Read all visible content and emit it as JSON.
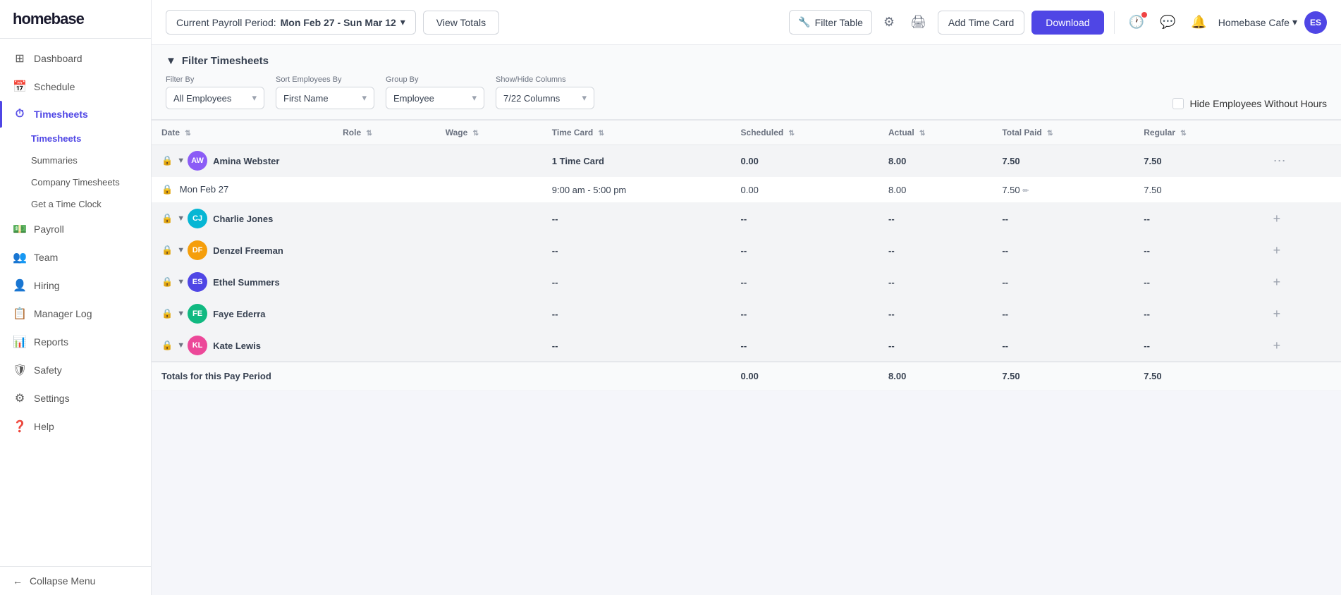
{
  "sidebar": {
    "logo": "homebase",
    "nav": [
      {
        "id": "dashboard",
        "label": "Dashboard",
        "icon": "⊞",
        "active": false
      },
      {
        "id": "schedule",
        "label": "Schedule",
        "icon": "📅",
        "active": false
      },
      {
        "id": "timesheets",
        "label": "Timesheets",
        "icon": "⏱",
        "active": true
      },
      {
        "id": "timesheets-sub",
        "label": "Timesheets",
        "sub": true,
        "active": true
      },
      {
        "id": "summaries-sub",
        "label": "Summaries",
        "sub": true,
        "active": false
      },
      {
        "id": "company-timesheets-sub",
        "label": "Company Timesheets",
        "sub": true,
        "active": false
      },
      {
        "id": "get-time-clock-sub",
        "label": "Get a Time Clock",
        "sub": true,
        "active": false
      },
      {
        "id": "payroll",
        "label": "Payroll",
        "icon": "💵",
        "active": false
      },
      {
        "id": "team",
        "label": "Team",
        "icon": "👥",
        "active": false
      },
      {
        "id": "hiring",
        "label": "Hiring",
        "icon": "👤",
        "active": false
      },
      {
        "id": "manager-log",
        "label": "Manager Log",
        "icon": "📋",
        "active": false
      },
      {
        "id": "reports",
        "label": "Reports",
        "icon": "📊",
        "active": false
      },
      {
        "id": "safety",
        "label": "Safety",
        "icon": "🛡",
        "active": false
      },
      {
        "id": "settings",
        "label": "Settings",
        "icon": "⚙",
        "active": false
      },
      {
        "id": "help",
        "label": "Help",
        "icon": "❓",
        "active": false
      }
    ],
    "collapse_label": "Collapse Menu"
  },
  "topbar": {
    "payroll_period_label": "Current Payroll Period:",
    "payroll_period_value": "Mon Feb 27 - Sun Mar 12",
    "view_totals_label": "View Totals",
    "filter_table_label": "Filter Table",
    "add_time_card_label": "Add Time Card",
    "download_label": "Download",
    "app_name": "Homebase Cafe",
    "user_initials": "ES",
    "has_notification": true
  },
  "filter": {
    "title": "Filter Timesheets",
    "filter_by_label": "Filter By",
    "filter_by_value": "All Employees",
    "sort_by_label": "Sort Employees By",
    "sort_by_value": "First Name",
    "group_by_label": "Group By",
    "group_by_value": "Employee",
    "show_hide_label": "Show/Hide Columns",
    "show_hide_value": "7/22 Columns",
    "hide_label": "Hide Employees Without Hours"
  },
  "table": {
    "columns": [
      {
        "id": "date",
        "label": "Date",
        "sortable": true
      },
      {
        "id": "role",
        "label": "Role",
        "sortable": true
      },
      {
        "id": "wage",
        "label": "Wage",
        "sortable": true
      },
      {
        "id": "time_card",
        "label": "Time Card",
        "sortable": true
      },
      {
        "id": "scheduled",
        "label": "Scheduled",
        "sortable": true
      },
      {
        "id": "actual",
        "label": "Actual",
        "sortable": true
      },
      {
        "id": "total_paid",
        "label": "Total Paid",
        "sortable": true
      },
      {
        "id": "regular",
        "label": "Regular",
        "sortable": true
      },
      {
        "id": "actions",
        "label": "",
        "sortable": false
      }
    ],
    "employees": [
      {
        "id": "amina-webster",
        "name": "Amina Webster",
        "initials": "AW",
        "color": "#8b5cf6",
        "time_cards": "1 Time Card",
        "scheduled": "0.00",
        "actual": "8.00",
        "total_paid": "7.50",
        "regular": "7.50",
        "rows": [
          {
            "date": "Mon Feb 27",
            "role": "",
            "wage": "",
            "time_card": "9:00 am - 5:00 pm",
            "scheduled": "0.00",
            "actual": "8.00",
            "total_paid": "7.50",
            "regular": "7.50"
          }
        ]
      },
      {
        "id": "charlie-jones",
        "name": "Charlie Jones",
        "initials": "CJ",
        "color": "#06b6d4",
        "time_cards": "--",
        "scheduled": "--",
        "actual": "--",
        "total_paid": "--",
        "regular": "--",
        "rows": []
      },
      {
        "id": "denzel-freeman",
        "name": "Denzel Freeman",
        "initials": "DF",
        "color": "#f59e0b",
        "time_cards": "--",
        "scheduled": "--",
        "actual": "--",
        "total_paid": "--",
        "regular": "--",
        "rows": []
      },
      {
        "id": "ethel-summers",
        "name": "Ethel Summers",
        "initials": "ES",
        "color": "#4f46e5",
        "time_cards": "--",
        "scheduled": "--",
        "actual": "--",
        "total_paid": "--",
        "regular": "--",
        "rows": []
      },
      {
        "id": "faye-ederra",
        "name": "Faye Ederra",
        "initials": "FE",
        "color": "#10b981",
        "time_cards": "--",
        "scheduled": "--",
        "actual": "--",
        "total_paid": "--",
        "regular": "--",
        "rows": []
      },
      {
        "id": "kate-lewis",
        "name": "Kate Lewis",
        "initials": "KL",
        "color": "#ec4899",
        "time_cards": "--",
        "scheduled": "--",
        "actual": "--",
        "total_paid": "--",
        "regular": "--",
        "rows": []
      }
    ],
    "totals": {
      "label": "Totals for this Pay Period",
      "scheduled": "0.00",
      "actual": "8.00",
      "total_paid": "7.50",
      "regular": "7.50"
    }
  }
}
